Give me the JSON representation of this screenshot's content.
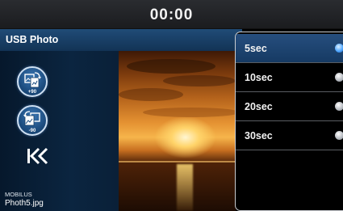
{
  "status_bar": {
    "clock": "00:00"
  },
  "header": {
    "title": "USB Photo"
  },
  "controls": {
    "rotate_right_label": "+90",
    "rotate_left_label": "-90",
    "back_symbol": "K<"
  },
  "file": {
    "folder": "MOBILUS",
    "name": "Photh5.jpg"
  },
  "slideshow_menu": {
    "items": [
      {
        "label": "5sec",
        "selected": true
      },
      {
        "label": "10sec",
        "selected": false
      },
      {
        "label": "20sec",
        "selected": false
      },
      {
        "label": "30sec",
        "selected": false
      }
    ]
  },
  "colors": {
    "header_blue": "#1a3f68",
    "selected_blue": "#1f4574",
    "accent_radio": "#3a8ff0"
  },
  "icons": [
    "rotate-right-icon",
    "rotate-left-icon",
    "back-icon",
    "radio-icon"
  ]
}
